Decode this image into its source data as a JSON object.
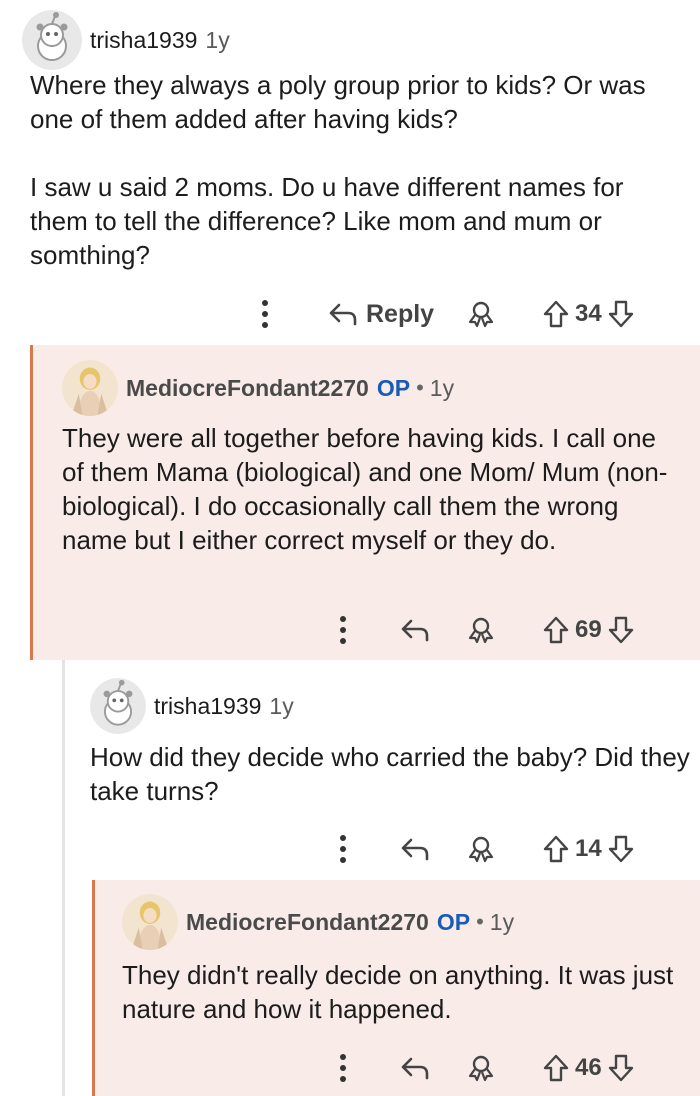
{
  "comments": [
    {
      "author": "trisha1939",
      "age": "1y",
      "paragraphs": [
        "Where they always a poly group prior to kids? Or was one of them added after having kids?",
        "I saw u said 2 moms. Do u have different names for them to tell the difference? Like mom and mum or somthing?"
      ],
      "reply_label": "Reply",
      "score": "34"
    },
    {
      "author": "MediocreFondant2270",
      "op_badge": "OP",
      "separator": "•",
      "age": "1y",
      "paragraphs": [
        "They were all together before having kids. I call one of them Mama (biological) and one Mom/ Mum (non-biological). I do occasionally call them the wrong name but I either correct myself or they do."
      ],
      "score": "69"
    },
    {
      "author": "trisha1939",
      "age": "1y",
      "paragraphs": [
        "How did they decide who carried the baby? Did they take turns?"
      ],
      "score": "14"
    },
    {
      "author": "MediocreFondant2270",
      "op_badge": "OP",
      "separator": "•",
      "age": "1y",
      "paragraphs": [
        "They didn't really decide on anything. It was just nature and how it happened."
      ],
      "score": "46"
    }
  ],
  "icons": {
    "more": "more-vertical-icon",
    "reply": "reply-arrow-icon",
    "award": "award-icon",
    "upvote": "upvote-arrow-icon",
    "downvote": "downvote-arrow-icon",
    "snoo_avatar": "snoo-avatar-icon",
    "user_avatar": "user-avatar-icon"
  },
  "colors": {
    "op_highlight": "#f9ece8",
    "op_rail": "#d9784f",
    "op_badge": "#1a5bb5",
    "thread_rail": "#e4e4e4"
  }
}
